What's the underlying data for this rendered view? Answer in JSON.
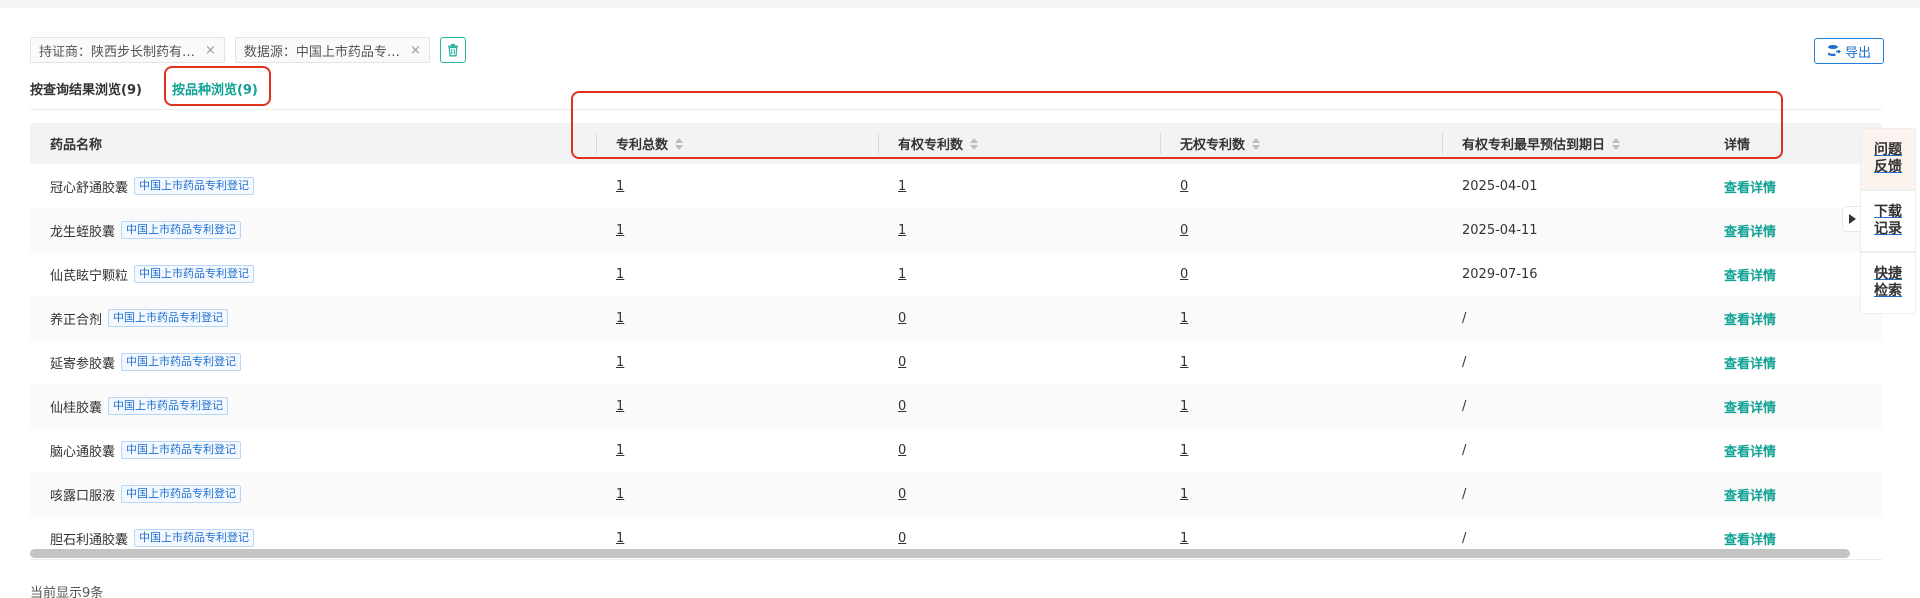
{
  "filters": [
    {
      "label": "持证商：陕西步长制药有…",
      "close": "×"
    },
    {
      "label": "数据源：中国上市药品专…",
      "close": "×"
    }
  ],
  "export_label": "导出",
  "tabs": [
    {
      "label": "按查询结果浏览(9)"
    },
    {
      "label": "按品种浏览(9)"
    }
  ],
  "table": {
    "headers": [
      "药品名称",
      "专利总数",
      "有权专利数",
      "无权专利数",
      "有权专利最早预估到期日",
      "详情"
    ],
    "rows": [
      {
        "name": "冠心舒通胶囊",
        "tag": "中国上市药品专利登记",
        "total": "1",
        "valid": "1",
        "invalid": "0",
        "expiry": "2025-04-01",
        "detail": "查看详情"
      },
      {
        "name": "龙生蛭胶囊",
        "tag": "中国上市药品专利登记",
        "total": "1",
        "valid": "1",
        "invalid": "0",
        "expiry": "2025-04-11",
        "detail": "查看详情"
      },
      {
        "name": "仙芪眩宁颗粒",
        "tag": "中国上市药品专利登记",
        "total": "1",
        "valid": "1",
        "invalid": "0",
        "expiry": "2029-07-16",
        "detail": "查看详情"
      },
      {
        "name": "养正合剂",
        "tag": "中国上市药品专利登记",
        "total": "1",
        "valid": "0",
        "invalid": "1",
        "expiry": "/",
        "detail": "查看详情"
      },
      {
        "name": "延寄参胶囊",
        "tag": "中国上市药品专利登记",
        "total": "1",
        "valid": "0",
        "invalid": "1",
        "expiry": "/",
        "detail": "查看详情"
      },
      {
        "name": "仙桂胶囊",
        "tag": "中国上市药品专利登记",
        "total": "1",
        "valid": "0",
        "invalid": "1",
        "expiry": "/",
        "detail": "查看详情"
      },
      {
        "name": "脑心通胶囊",
        "tag": "中国上市药品专利登记",
        "total": "1",
        "valid": "0",
        "invalid": "1",
        "expiry": "/",
        "detail": "查看详情"
      },
      {
        "name": "咳露口服液",
        "tag": "中国上市药品专利登记",
        "total": "1",
        "valid": "0",
        "invalid": "1",
        "expiry": "/",
        "detail": "查看详情"
      },
      {
        "name": "胆石利通胶囊",
        "tag": "中国上市药品专利登记",
        "total": "1",
        "valid": "0",
        "invalid": "1",
        "expiry": "/",
        "detail": "查看详情"
      }
    ]
  },
  "footer_text": "当前显示9条",
  "side_menu": [
    "问题反馈",
    "下载记录",
    "快捷检索"
  ],
  "colors": {
    "accent": "#0fa294",
    "link_blue": "#1f6fd0",
    "annotation_red": "#e0301e"
  },
  "icons": [
    "trash-icon",
    "export-icon",
    "sort-icon",
    "close-icon",
    "collapse-arrow-icon"
  ]
}
